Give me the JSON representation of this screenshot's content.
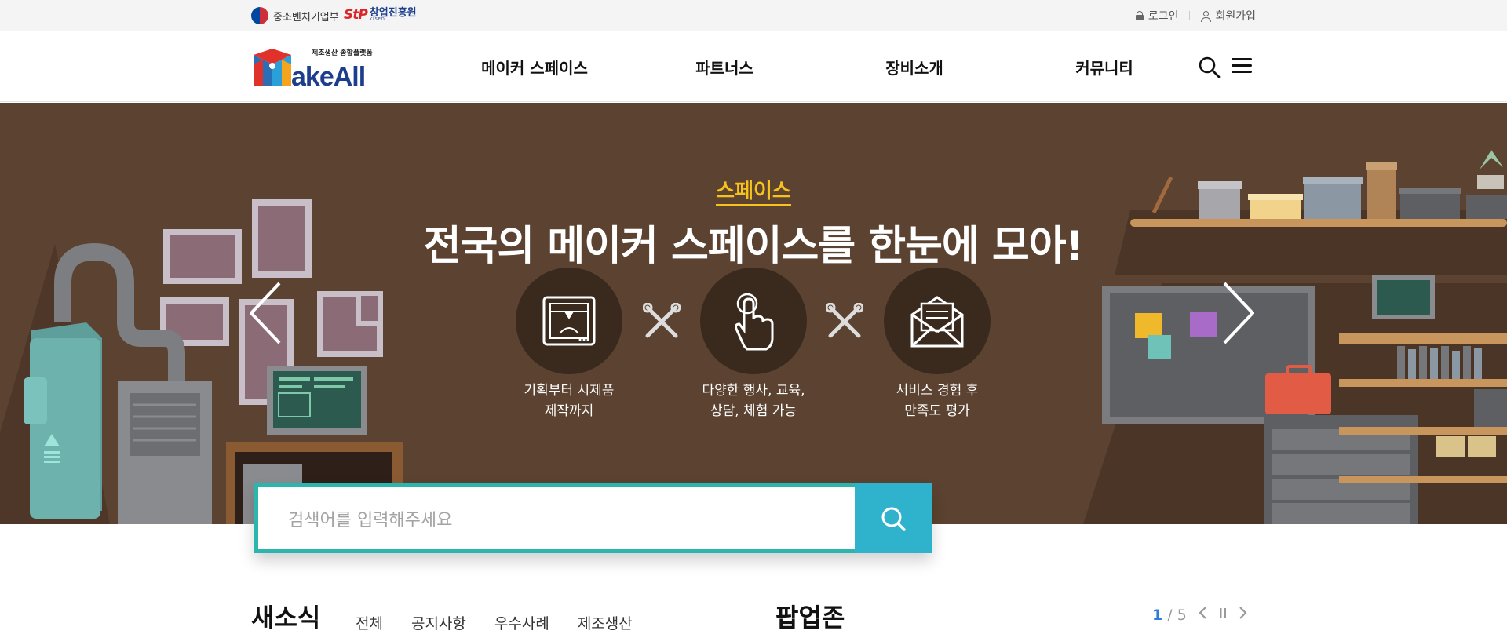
{
  "topbar": {
    "gov_label": "중소벤처기업부",
    "startup_logo_text": "StP",
    "startup_org_name": "창업진흥원",
    "startup_org_sub": "KISED",
    "login_label": "로그인",
    "signup_label": "회원가입"
  },
  "header": {
    "logo_tagline": "제조생산 종합플랫폼",
    "logo_text": "MakeAll",
    "nav": [
      "메이커 스페이스",
      "파트너스",
      "장비소개",
      "커뮤니티"
    ]
  },
  "hero": {
    "subtitle": "스페이스",
    "title": "전국의 메이커 스페이스를 한눈에 모아!",
    "features": [
      {
        "icon": "3d-printer-icon",
        "text": "기획부터 시제품\n제작까지"
      },
      {
        "icon": "hand-touch-icon",
        "text": "다양한 행사, 교육,\n상담, 체험 가능"
      },
      {
        "icon": "envelope-letter-icon",
        "text": "서비스 경험 후\n만족도 평가"
      }
    ]
  },
  "search": {
    "placeholder": "검색어를 입력해주세요"
  },
  "news": {
    "title": "새소식",
    "tabs": [
      "전체",
      "공지사항",
      "우수사례",
      "제조생산"
    ]
  },
  "popup": {
    "title": "팝업존",
    "current_page": "1",
    "separator": "/",
    "total_pages": "5"
  },
  "colors": {
    "accent_teal": "#2cb5ad",
    "search_button": "#2fb2cc",
    "hero_background": "#5c4230",
    "hero_subtitle": "#f6c31c",
    "page_current": "#2b7fd8"
  }
}
